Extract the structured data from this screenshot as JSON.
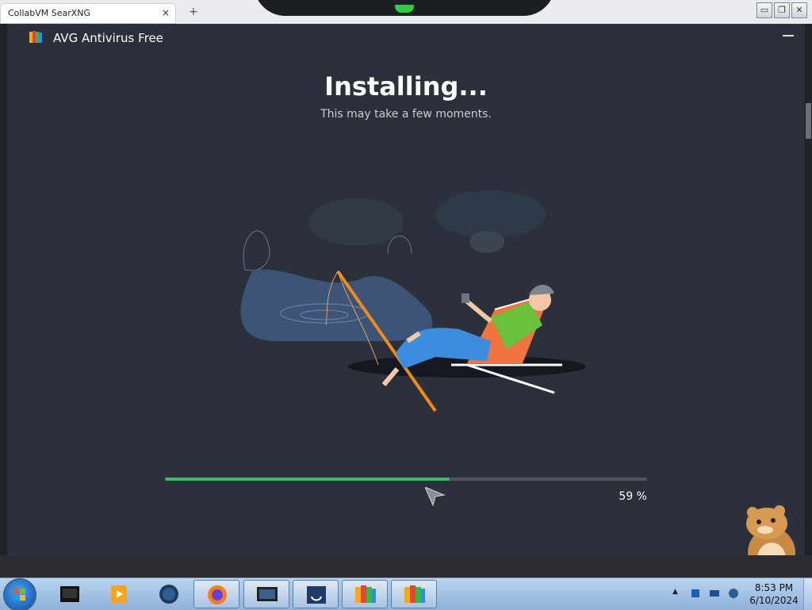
{
  "browser": {
    "tab_title": "CollabVM SearXNG",
    "tab_close": "×",
    "new_tab": "+"
  },
  "window_controls": {
    "minimize": "▭",
    "restore": "❐",
    "close": "✕"
  },
  "app": {
    "title": "AVG Antivirus Free",
    "heading": "Installing...",
    "subheading": "This may take a few moments.",
    "progress": {
      "percent": 59,
      "label": "59 %"
    },
    "colors": {
      "background": "#2b303b",
      "progress_fill": "#3fb86a",
      "progress_track": "#505560"
    }
  },
  "taskbar": {
    "items": [
      {
        "name": "media-player-icon"
      },
      {
        "name": "vlc-icon"
      },
      {
        "name": "globe-icon"
      },
      {
        "name": "firefox-icon"
      },
      {
        "name": "screen-icon"
      },
      {
        "name": "installer-icon"
      },
      {
        "name": "avg-icon"
      },
      {
        "name": "avg-icon"
      }
    ],
    "clock_time": "8:53 PM",
    "clock_date": "6/10/2024"
  }
}
